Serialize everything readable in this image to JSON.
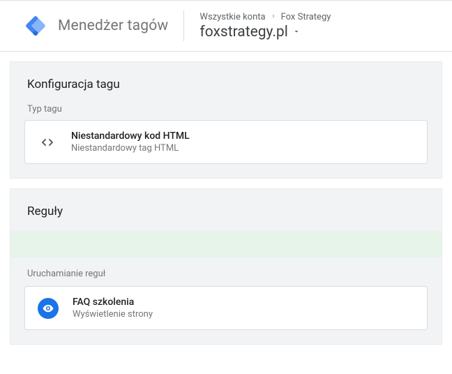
{
  "header": {
    "app_title": "Menedżer tagów",
    "breadcrumb_all": "Wszystkie konta",
    "breadcrumb_account": "Fox Strategy",
    "container_name": "foxstrategy.pl"
  },
  "tag_config": {
    "panel_title": "Konfiguracja tagu",
    "type_label": "Typ tagu",
    "tile_title": "Niestandardowy kod HTML",
    "tile_subtitle": "Niestandardowy tag HTML"
  },
  "rules": {
    "panel_title": "Reguły",
    "firing_label": "Uruchamianie reguł",
    "tile_title": "FAQ szkolenia",
    "tile_subtitle": "Wyświetlenie strony"
  }
}
